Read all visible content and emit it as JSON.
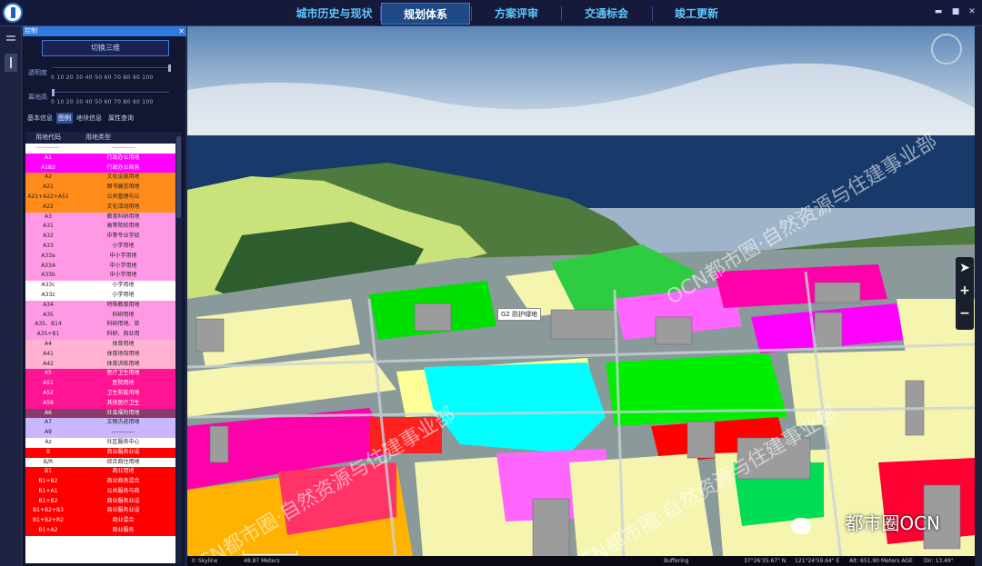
{
  "nav": {
    "tabs": [
      "城市历史与现状",
      "规划体系",
      "方案评审",
      "交通标会",
      "竣工更新"
    ],
    "active_tab": "规划体系"
  },
  "panel": {
    "title": "控制",
    "toggle_3d_label": "切换三维",
    "opacity_label": "透明度",
    "height_label": "离地高",
    "slider_ticks": "0  10  20  30  40  50  60  70  80  90  100",
    "tabs": [
      "基本信息",
      "图例",
      "地块信息",
      "属性查询"
    ],
    "active_tab": "图例",
    "legend_headers": [
      "用地代码",
      "用地类型"
    ],
    "legend_rows": [
      {
        "code": "------------",
        "name": "------------",
        "color": "#ffffff",
        "text": "#666"
      },
      {
        "code": "A1",
        "name": "行政办公用地",
        "color": "#ff00ff",
        "text": "#fff"
      },
      {
        "code": "A1B2",
        "name": "行政办公商务",
        "color": "#ff00ff",
        "text": "#fff"
      },
      {
        "code": "A2",
        "name": "文化设施用地",
        "color": "#ff8c1a",
        "text": "#222"
      },
      {
        "code": "A21",
        "name": "图书展览用地",
        "color": "#ff8c1a",
        "text": "#222"
      },
      {
        "code": "A21+A22+A51",
        "name": "公共管理与公",
        "color": "#ff8c1a",
        "text": "#222"
      },
      {
        "code": "A22",
        "name": "文化活动用地",
        "color": "#ff8c1a",
        "text": "#222"
      },
      {
        "code": "A3",
        "name": "教育科研用地",
        "color": "#ff99e6",
        "text": "#222"
      },
      {
        "code": "A31",
        "name": "高等院校用地",
        "color": "#ff99e6",
        "text": "#222"
      },
      {
        "code": "A32",
        "name": "中等专业学校",
        "color": "#ff99e6",
        "text": "#222"
      },
      {
        "code": "A33",
        "name": "小学用地",
        "color": "#ff99e6",
        "text": "#222"
      },
      {
        "code": "A33a",
        "name": "中小学用地",
        "color": "#ff99e6",
        "text": "#222"
      },
      {
        "code": "A33A",
        "name": "中小学用地",
        "color": "#ff99e6",
        "text": "#222"
      },
      {
        "code": "A33b",
        "name": "中小学用地",
        "color": "#ff99e6",
        "text": "#222"
      },
      {
        "code": "A33c",
        "name": "小学用地",
        "color": "#ffffff",
        "text": "#222"
      },
      {
        "code": "A33z",
        "name": "小学用地",
        "color": "#ffffff",
        "text": "#222"
      },
      {
        "code": "A34",
        "name": "特殊教育用地",
        "color": "#ff99e6",
        "text": "#222"
      },
      {
        "code": "A35",
        "name": "科研用地",
        "color": "#ff99e6",
        "text": "#222"
      },
      {
        "code": "A35、B14",
        "name": "科研用地、旅",
        "color": "#ff99e6",
        "text": "#222"
      },
      {
        "code": "A35+B1",
        "name": "科研、商业用",
        "color": "#ff99e6",
        "text": "#222"
      },
      {
        "code": "A4",
        "name": "体育用地",
        "color": "#ffb3d1",
        "text": "#222"
      },
      {
        "code": "A41",
        "name": "体育场馆用地",
        "color": "#ffb3d1",
        "text": "#222"
      },
      {
        "code": "A42",
        "name": "体育训练用地",
        "color": "#ffb3d1",
        "text": "#222"
      },
      {
        "code": "A5",
        "name": "医疗卫生用地",
        "color": "#ff1493",
        "text": "#fff"
      },
      {
        "code": "A51",
        "name": "医院用地",
        "color": "#ff1493",
        "text": "#fff"
      },
      {
        "code": "A52",
        "name": "卫生防疫用地",
        "color": "#ff1493",
        "text": "#fff"
      },
      {
        "code": "A59",
        "name": "其他医疗卫生",
        "color": "#ff1493",
        "text": "#fff"
      },
      {
        "code": "A6",
        "name": "社会福利用地",
        "color": "#8a3a6a",
        "text": "#fff"
      },
      {
        "code": "A7",
        "name": "文物古迹用地",
        "color": "#c9b6ff",
        "text": "#222"
      },
      {
        "code": "A9",
        "name": "------------",
        "color": "#c9b6ff",
        "text": "#222"
      },
      {
        "code": "Az",
        "name": "社区服务中心",
        "color": "#ffffff",
        "text": "#222"
      },
      {
        "code": "B",
        "name": "商业服务业设",
        "color": "#ff0000",
        "text": "#fff"
      },
      {
        "code": "B/R",
        "name": "综合商住用地",
        "color": "#ffffff",
        "text": "#222"
      },
      {
        "code": "B1",
        "name": "商业用地",
        "color": "#ff0000",
        "text": "#fff"
      },
      {
        "code": "B1+B2",
        "name": "商业商务混合",
        "color": "#ff0000",
        "text": "#fff"
      },
      {
        "code": "B1+A1",
        "name": "公共服务与商",
        "color": "#ff0000",
        "text": "#fff"
      },
      {
        "code": "B1+B2",
        "name": "商业服务业设",
        "color": "#ff0000",
        "text": "#fff"
      },
      {
        "code": "B1+B2+B3",
        "name": "商业服务业设",
        "color": "#ff0000",
        "text": "#fff"
      },
      {
        "code": "B1+B2+R2",
        "name": "商业混合",
        "color": "#ff0000",
        "text": "#fff"
      },
      {
        "code": "B1+A2",
        "name": "商业服务",
        "color": "#ff0000",
        "text": "#fff"
      }
    ]
  },
  "map": {
    "label_code": "G2",
    "label_name": "防护绿地",
    "scale_text": "48.87 Meters",
    "skyline": "© Skyline",
    "status_buffering": "Buffering",
    "status_lat": "37°26'35.67\" N",
    "status_lon": "121°24'59.64\" E",
    "status_alt": "Alt: 651.90 Meters AGE",
    "status_dir": "Dir: 13.49°",
    "watermark": "OCN都市圈·自然资源与住建事业部",
    "brand_text": "都市圈OCN"
  },
  "colors": {
    "accent": "#2f7ae0",
    "nav_text": "#5ec6ff",
    "bg": "#161a3a"
  }
}
